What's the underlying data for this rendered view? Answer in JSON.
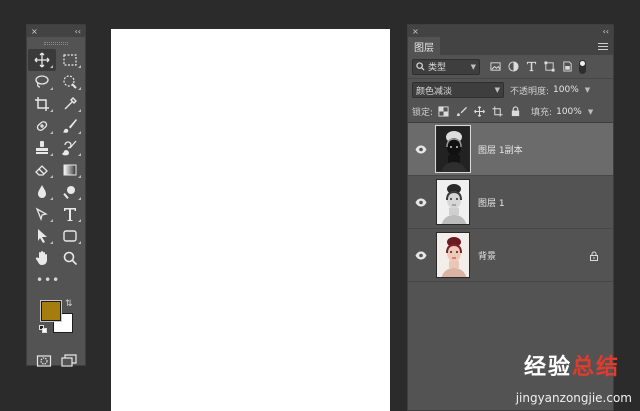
{
  "tools_panel": {
    "close_glyph": "×",
    "collapse_glyph": "‹‹",
    "more_glyph": "•••",
    "swap_glyph": "⇅",
    "foreground_color": "#a57d0f",
    "background_color": "#ffffff",
    "tool_icons": [
      "move-icon",
      "marquee-icon",
      "lasso-icon",
      "quick-select-icon",
      "crop-icon",
      "eyedropper-icon",
      "healing-brush-icon",
      "brush-icon",
      "clone-stamp-icon",
      "history-brush-icon",
      "eraser-icon",
      "gradient-icon",
      "blur-icon",
      "dodge-icon",
      "pen-icon",
      "type-icon",
      "path-select-icon",
      "rectangle-icon",
      "hand-icon",
      "zoom-icon"
    ]
  },
  "canvas": {
    "background": "#ffffff"
  },
  "layers_panel": {
    "close_glyph": "×",
    "collapse_glyph": "‹‹",
    "tab_label": "图层",
    "filter_label": "类型",
    "blend_mode": "颜色减淡",
    "opacity_label": "不透明度:",
    "opacity_value": "100%",
    "lock_label": "锁定:",
    "fill_label": "填充:",
    "fill_value": "100%",
    "layers": [
      {
        "name": "图层 1副本",
        "active": true,
        "locked": false
      },
      {
        "name": "图层 1",
        "active": false,
        "locked": false
      },
      {
        "name": "背景",
        "active": false,
        "locked": true
      }
    ]
  },
  "watermark": {
    "text_a": "经验",
    "text_b": "总结",
    "url": "jingyanzongjie.com"
  }
}
